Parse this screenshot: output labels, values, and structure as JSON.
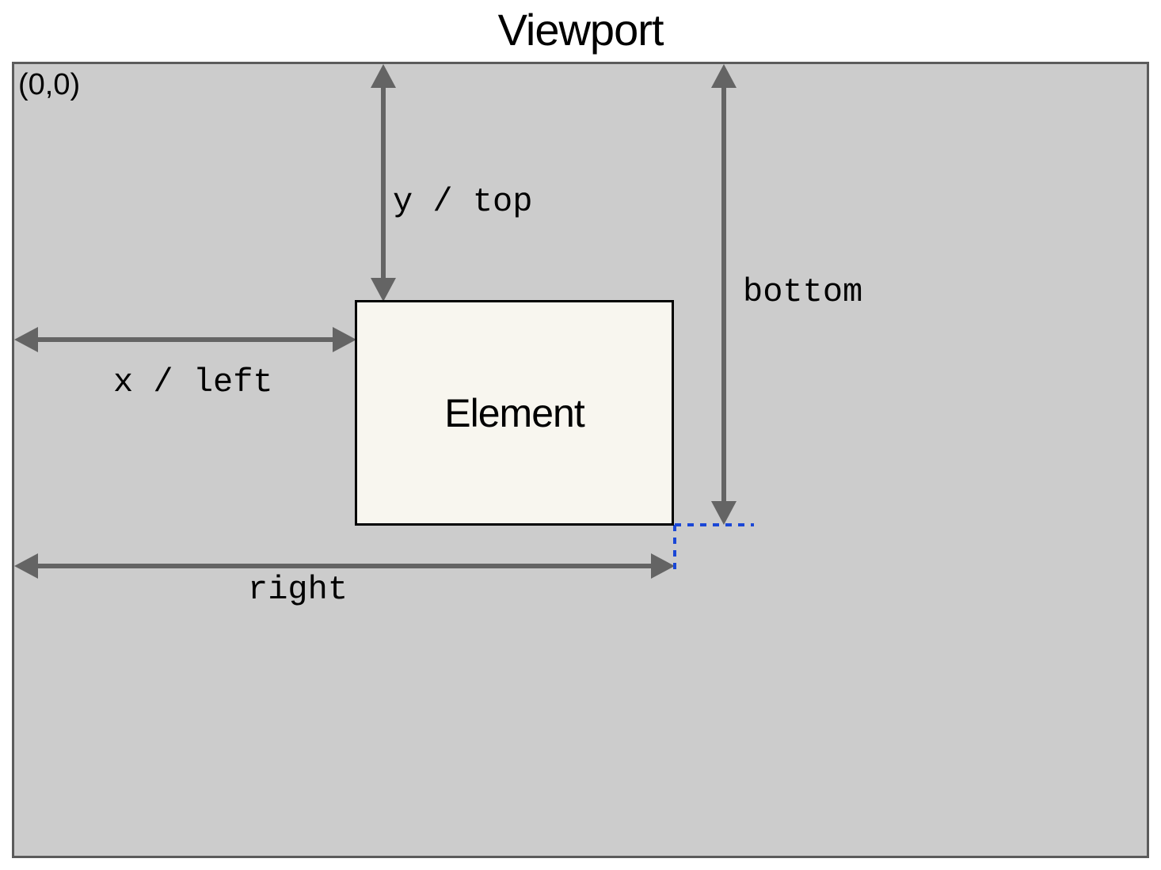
{
  "title": "Viewport",
  "origin": "(0,0)",
  "element": "Element",
  "labels": {
    "xleft": "x / left",
    "ytop": "y / top",
    "bottom": "bottom",
    "right": "right"
  },
  "colors": {
    "viewport_bg": "#cccccc",
    "viewport_border": "#5b5b5b",
    "element_bg": "#f8f6ef",
    "element_border": "#000000",
    "arrow": "#646464",
    "dash": "#1a47d6"
  }
}
